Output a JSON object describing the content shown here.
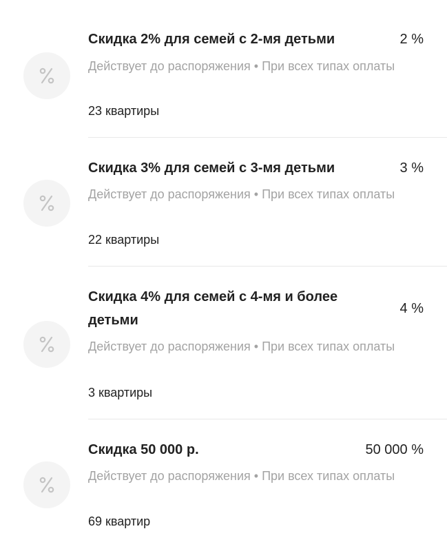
{
  "discounts": [
    {
      "title": "Скидка 2% для семей с 2-мя детьми",
      "value": "2 %",
      "description": "Действует до распоряжения • При всех типах оплаты",
      "count": "23 квартиры",
      "icon": "percent-icon"
    },
    {
      "title": "Скидка 3% для семей с 3-мя детьми",
      "value": "3 %",
      "description": "Действует до распоряжения • При всех типах оплаты",
      "count": "22 квартиры",
      "icon": "percent-icon"
    },
    {
      "title": "Скидка 4% для семей с 4-мя и более детьми",
      "value": "4 %",
      "description": "Действует до распоряжения • При всех типах оплаты",
      "count": "3 квартиры",
      "icon": "percent-icon"
    },
    {
      "title": "Скидка 50 000 р.",
      "value": "50 000 %",
      "description": "Действует до распоряжения • При всех типах оплаты",
      "count": "69 квартир",
      "icon": "percent-icon"
    }
  ],
  "colors": {
    "title": "#222222",
    "secondary_text": "#a3a3a3",
    "icon_bg": "#f4f4f4",
    "icon_glyph": "#c4c4c4",
    "divider": "#e8e8e8"
  }
}
